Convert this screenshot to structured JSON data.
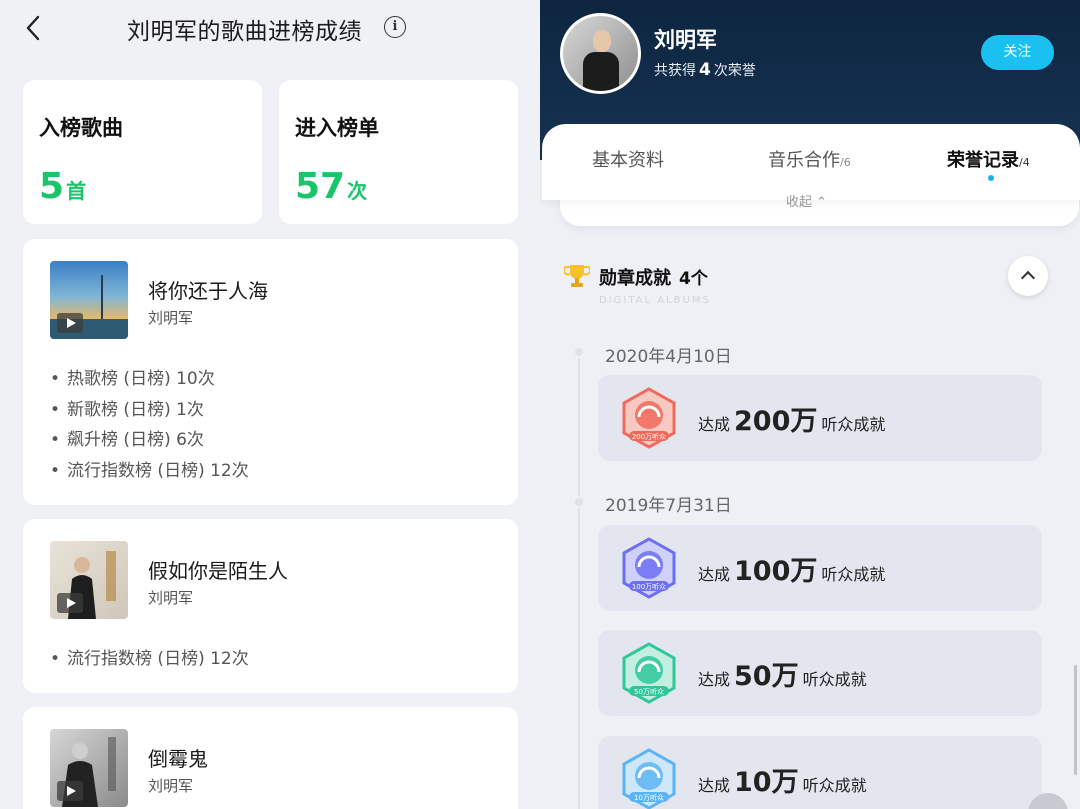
{
  "left": {
    "title": "刘明军的歌曲进榜成绩",
    "stats": [
      {
        "label": "入榜歌曲",
        "value": "5",
        "unit": "首"
      },
      {
        "label": "进入榜单",
        "value": "57",
        "unit": "次"
      }
    ],
    "songs": [
      {
        "title": "将你还于人海",
        "artist": "刘明军",
        "charts": [
          "热歌榜 (日榜) 10次",
          "新歌榜 (日榜) 1次",
          "飙升榜 (日榜) 6次",
          "流行指数榜 (日榜) 12次"
        ]
      },
      {
        "title": "假如你是陌生人",
        "artist": "刘明军",
        "charts": [
          "流行指数榜 (日榜) 12次"
        ]
      },
      {
        "title": "倒霉鬼",
        "artist": "刘明军",
        "charts": []
      }
    ]
  },
  "right": {
    "artist_name": "刘明军",
    "honor_prefix": "共获得",
    "honor_num": "4",
    "honor_suffix": "次荣誉",
    "follow_label": "关注",
    "tabs": [
      {
        "label": "基本资料",
        "count": ""
      },
      {
        "label": "音乐合作",
        "count": "/6"
      },
      {
        "label": "荣誉记录",
        "count": "/4"
      }
    ],
    "active_tab": "荣誉记录",
    "collapse_label": "收起 ⌃",
    "medal_title": "勋章成就",
    "medal_count": "4个",
    "medal_subtitle": "DIGITAL ALBUMS",
    "timeline": [
      {
        "date": "2020年4月10日"
      },
      {
        "date": "2019年7月31日"
      }
    ],
    "achievements": [
      {
        "prefix": "达成",
        "value": "200万",
        "suffix": "听众成就",
        "badge_label": "200万听众",
        "color": "#f06a5a"
      },
      {
        "prefix": "达成",
        "value": "100万",
        "suffix": "听众成就",
        "badge_label": "100万听众",
        "color": "#6b6ff2"
      },
      {
        "prefix": "达成",
        "value": "50万",
        "suffix": "听众成就",
        "badge_label": "50万听众",
        "color": "#2fc79a"
      },
      {
        "prefix": "达成",
        "value": "10万",
        "suffix": "听众成就",
        "badge_label": "10万听众",
        "color": "#5ab4f5"
      }
    ]
  }
}
